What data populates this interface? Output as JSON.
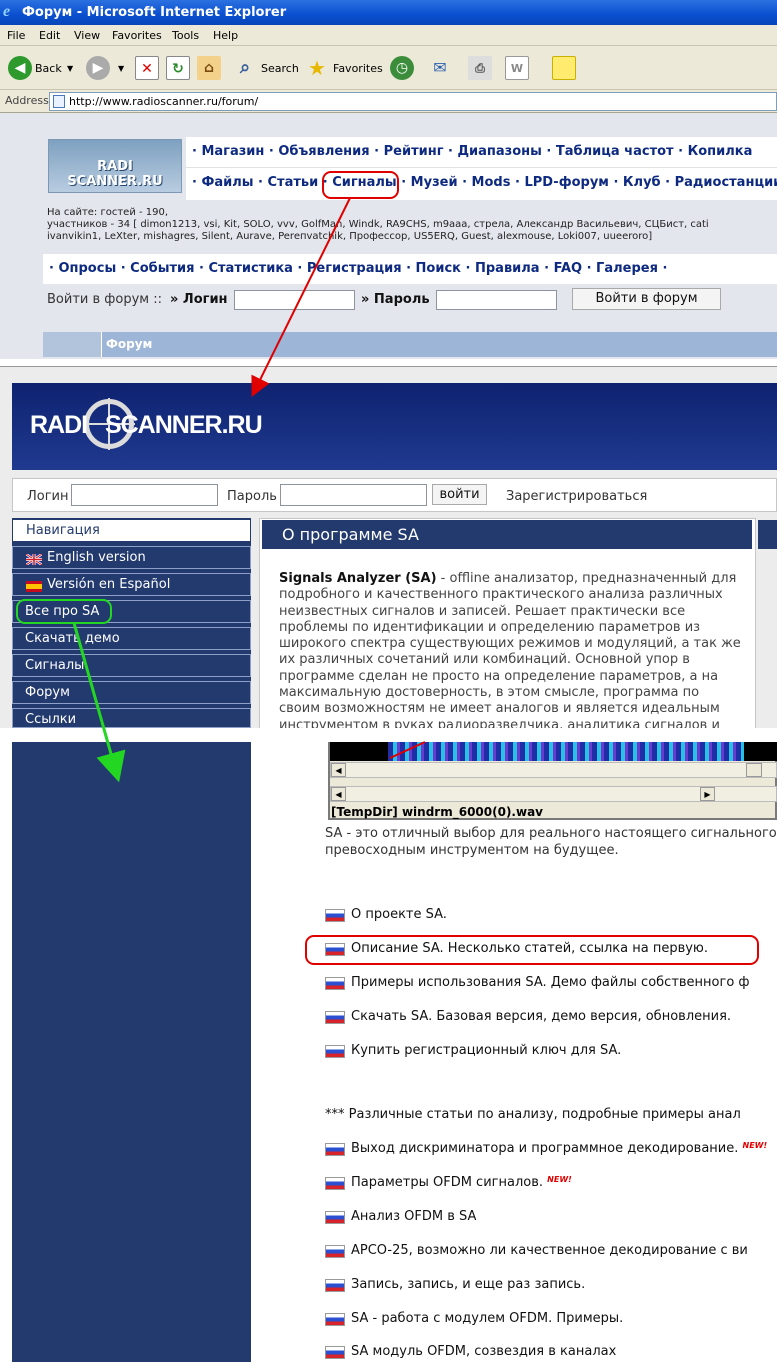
{
  "window": {
    "title": "Форум - Microsoft Internet Explorer"
  },
  "menu": [
    "File",
    "Edit",
    "View",
    "Favorites",
    "Tools",
    "Help"
  ],
  "toolbar": {
    "back": "Back",
    "search": "Search",
    "favorites": "Favorites"
  },
  "address": {
    "label": "Address",
    "url": "http://www.radioscanner.ru/forum/"
  },
  "forum": {
    "logo_text": "RADI SCANNER.RU",
    "nav1": "· Магазин · Объявления · Рейтинг · Диапазоны · Таблица частот · Копилка",
    "nav2": "· Файлы · Статьи · Сигналы · Музей · Mods · LPD-форум · Клуб · Радиостанции",
    "online_line1": "На сайте: гостей - 190,",
    "online_line2": "участников - 34 [ dimon1213, vsi, Kit, SOLO, vvv, GolfMan, Windk, RA9CHS, m9aaa, стрела, Александр Васильевич, СЦБист, cati",
    "online_line3": "ivanvikin1, LeXter, mishagres, Silent, Aurave, Pereпvatchik, Профессор, US5ERQ, Guest, alexmouse, Loki007, uueeroro]",
    "nav3": "· Опросы · События · Статистика · Регистрация · Поиск · Правила · FAQ · Галерея ·",
    "login_prompt": "Войти в форум ::",
    "login_label": "» Логин",
    "password_label": "» Пароль",
    "login_button": "Войти в форум",
    "forum_header": "Форум"
  },
  "site": {
    "logo": "RADI   SCANNER.RU",
    "login_label": "Логин",
    "password_label": "Пароль",
    "login_button": "войти",
    "register": "Зарегистрироваться",
    "nav_header": "Навигация",
    "nav": [
      "English version",
      "Versión en Español",
      "Все про SA",
      "Скачать демо",
      "Сигналы",
      "Форум",
      "Ссылки"
    ],
    "content_title": "О программе SA",
    "intro_bold": "Signals Analyzer (SA)",
    "intro_text": " - offline анализатор, предназначенный для подробного и качественного практического анализа различных неизвестных сигналов и записей. Решает практически все проблемы по идентификации и определению параметров из широкого спектра существующих режимов и модуляций, а так же их различных сочетаний или комбинаций. Основной упор в программе сделан не просто на определение параметров, а на максимальную достоверность, в этом смысле, программа по своим возможностям не имеет аналогов и является идеальным инструментом в руках радиоразведчика, аналитика сигналов и"
  },
  "article": {
    "player_file": "[TempDir] windrm_6000(0).wav",
    "para_line1": "SA - это отличный выбор для реального настоящего сигнального",
    "para_line2": "превосходным инструментом на будущее.",
    "links": [
      "О проекте SA.",
      "Описание SA. Несколько статей, ссылка на первую.",
      "Примеры использования SA. Демо файлы собственного ф",
      "Скачать SA. Базовая версия, демо версия, обновления.",
      "Купить регистрационный ключ для SA."
    ],
    "articles_header": "*** Различные статьи по анализу, подробные примеры анал",
    "articles": [
      "Выход дискриминатора и программное декодирование.",
      "Параметры OFDM сигналов.",
      "Анализ OFDM в SA",
      "APCO-25, возможно ли качественное декодирование с ви",
      "Запись, запись, и еще раз запись.",
      "SA - работа с модулем OFDM. Примеры.",
      "SA модуль OFDM, созвездия в каналах"
    ],
    "new_badge": "NEW!"
  },
  "colors": {
    "accent_red": "#e00000",
    "accent_green": "#22d622",
    "site_navy": "#233a6e"
  }
}
